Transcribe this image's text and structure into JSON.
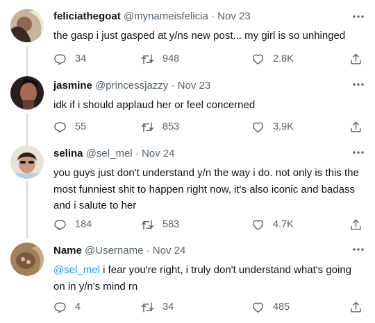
{
  "colors": {
    "link": "#1d9bf0",
    "muted": "#536471",
    "text": "#0f1419",
    "thread_line": "#cfd9de"
  },
  "tweets": [
    {
      "display_name": "feliciathegoat",
      "handle": "@mynameisfelicia",
      "date_sep": " · ",
      "date": "Nov 23",
      "text": "the gasp i just gasped at y/ns new post... my girl is so unhinged",
      "replies": "34",
      "retweets": "948",
      "likes": "2.8K"
    },
    {
      "display_name": "jasmine",
      "handle": "@princessjazzy",
      "date_sep": " · ",
      "date": "Nov 23",
      "text": "idk if i should applaud her or feel concerned",
      "replies": "55",
      "retweets": "853",
      "likes": "3.9K"
    },
    {
      "display_name": "selina",
      "handle": "@sel_mel",
      "date_sep": " · ",
      "date": "Nov 24",
      "text": "you guys just don't understand y/n the way i do. not only is this the most funniest shit to happen right now, it's also iconic and badass and i salute to her",
      "replies": "184",
      "retweets": "583",
      "likes": "4.7K"
    },
    {
      "display_name": "Name",
      "handle": "@Username",
      "date_sep": " · ",
      "date": "Nov 24",
      "mention": "@sel_mel",
      "text": " i fear you're right, i truly don't understand what's going on in y/n's mind rn",
      "replies": "4",
      "retweets": "34",
      "likes": "485"
    }
  ]
}
